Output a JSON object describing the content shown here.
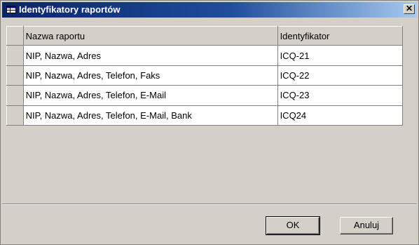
{
  "window": {
    "title": "Identyfikatory raportów",
    "close_glyph": "✕"
  },
  "table": {
    "columns": [
      "Nazwa raportu",
      "Identyfikator"
    ],
    "rows": [
      [
        "NIP, Nazwa, Adres",
        "ICQ-21"
      ],
      [
        "NIP, Nazwa, Adres, Telefon, Faks",
        "ICQ-22"
      ],
      [
        "NIP, Nazwa, Adres, Telefon, E-Mail",
        "ICQ-23"
      ],
      [
        "NIP, Nazwa, Adres, Telefon, E-Mail, Bank",
        "ICQ24"
      ]
    ]
  },
  "buttons": {
    "ok": "OK",
    "cancel": "Anuluj"
  },
  "colors": {
    "title_start": "#0a246a",
    "title_end": "#a6caf0",
    "face": "#d4d0c8"
  },
  "icons": {
    "title_icon": "table-icon",
    "close_icon": "close-icon"
  }
}
